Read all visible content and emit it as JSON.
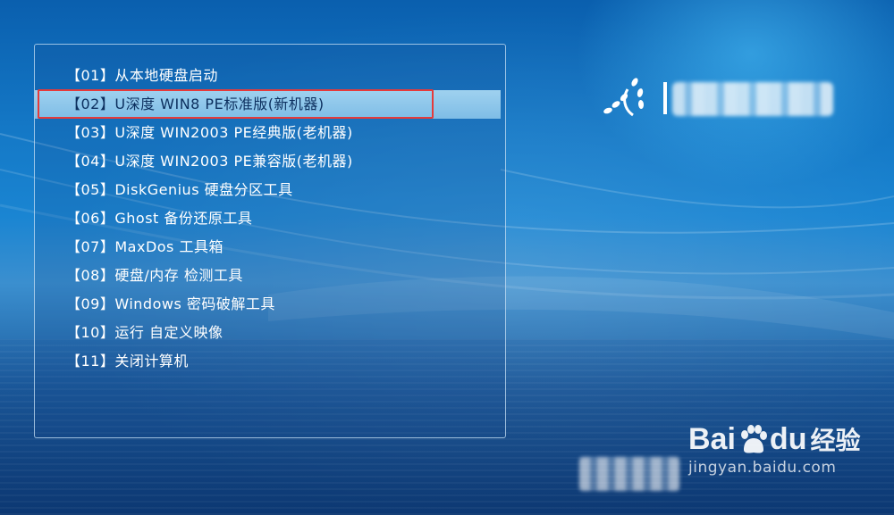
{
  "menu": {
    "items": [
      {
        "label": "【01】从本地硬盘启动"
      },
      {
        "label": "【02】U深度 WIN8 PE标准版(新机器)"
      },
      {
        "label": "【03】U深度 WIN2003 PE经典版(老机器)"
      },
      {
        "label": "【04】U深度 WIN2003 PE兼容版(老机器)"
      },
      {
        "label": "【05】DiskGenius 硬盘分区工具"
      },
      {
        "label": "【06】Ghost 备份还原工具"
      },
      {
        "label": "【07】MaxDos 工具箱"
      },
      {
        "label": "【08】硬盘/内存 检测工具"
      },
      {
        "label": "【09】Windows 密码破解工具"
      },
      {
        "label": "【10】运行 自定义映像"
      },
      {
        "label": "【11】关闭计算机"
      }
    ],
    "selected_index": 1
  },
  "watermark": {
    "bai": "Bai",
    "du": "du",
    "jingyan": "经验",
    "url": "jingyan.baidu.com"
  },
  "colors": {
    "selection_bg": "#8cc8ea",
    "annotation_border": "#e53a3a",
    "text": "#ffffff"
  }
}
